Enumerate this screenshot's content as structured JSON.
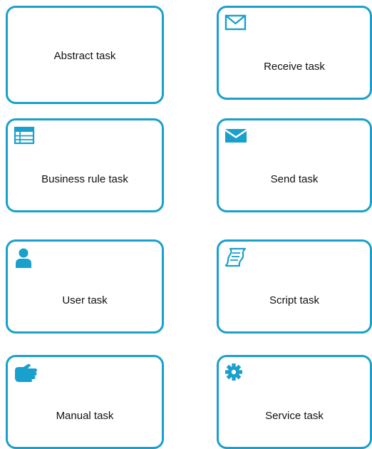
{
  "colors": {
    "border": "#1aa0cc",
    "icon": "#1aa0cc",
    "text": "#111111",
    "background": "#ffffff"
  },
  "tasks": [
    {
      "label": "Abstract task",
      "icon": ""
    },
    {
      "label": "Receive task",
      "icon": "envelope-outline-icon"
    },
    {
      "label": "Business rule task",
      "icon": "table-icon"
    },
    {
      "label": "Send task",
      "icon": "envelope-filled-icon"
    },
    {
      "label": "User task",
      "icon": "user-icon"
    },
    {
      "label": "Script task",
      "icon": "script-icon"
    },
    {
      "label": "Manual task",
      "icon": "hand-icon"
    },
    {
      "label": "Service task",
      "icon": "gear-icon"
    }
  ]
}
